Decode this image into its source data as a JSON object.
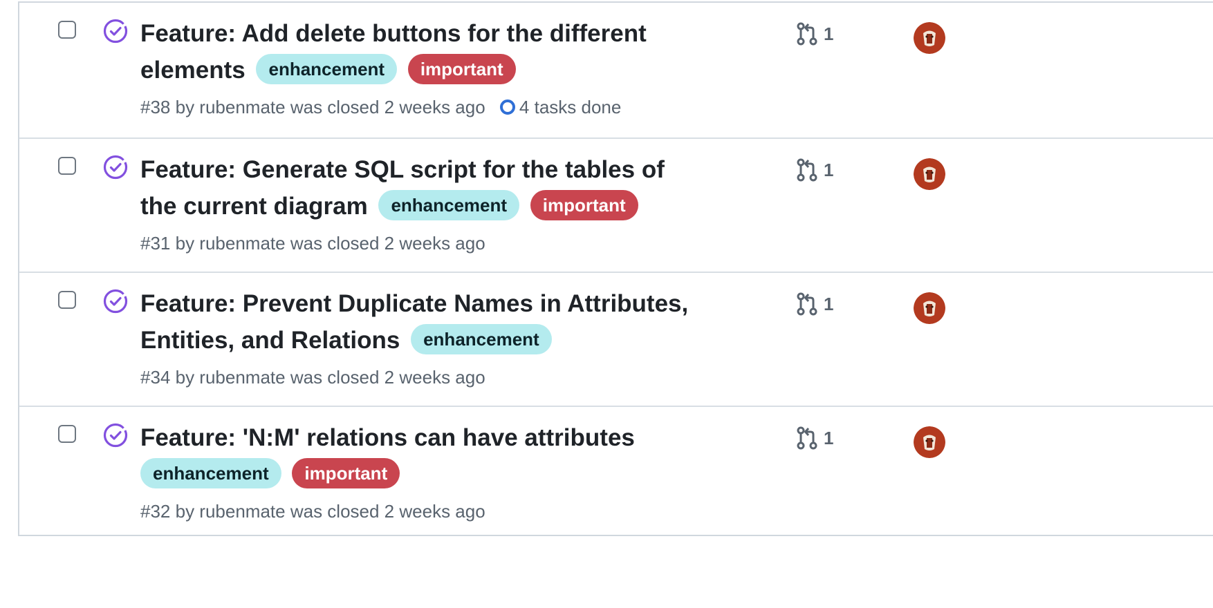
{
  "issues": [
    {
      "title_lines": [
        "Feature: Add delete buttons for the different",
        "elements"
      ],
      "labels": [
        "enhancement",
        "important"
      ],
      "number": "#38",
      "author_text": "by rubenmate",
      "status_text": "was closed 2 weeks ago",
      "tasks": "4 tasks done",
      "pr_count": "1"
    },
    {
      "title_lines": [
        "Feature: Generate SQL script for the tables of",
        "the current diagram"
      ],
      "labels": [
        "enhancement",
        "important"
      ],
      "number": "#31",
      "author_text": "by rubenmate",
      "status_text": "was closed 2 weeks ago",
      "pr_count": "1"
    },
    {
      "title_lines": [
        "Feature: Prevent Duplicate Names in Attributes,",
        "Entities, and Relations"
      ],
      "labels": [
        "enhancement"
      ],
      "number": "#34",
      "author_text": "by rubenmate",
      "status_text": "was closed 2 weeks ago",
      "pr_count": "1"
    },
    {
      "title_lines": [
        "Feature: 'N:M' relations can have attributes"
      ],
      "labels": [
        "enhancement",
        "important"
      ],
      "number": "#32",
      "author_text": "by rubenmate",
      "status_text": "was closed 2 weeks ago",
      "pr_count": "1"
    }
  ],
  "icons": {
    "state": "completed-issue-icon",
    "pull_request": "pull-request-icon",
    "tasks": "task-progress-icon"
  },
  "colors": {
    "completed_purple": "#8250df",
    "label_enhancement_bg": "#b4ebee",
    "label_important_bg": "#c9454f",
    "task_ring": "#2f6fd6",
    "avatar_bg": "#b33a1f"
  }
}
